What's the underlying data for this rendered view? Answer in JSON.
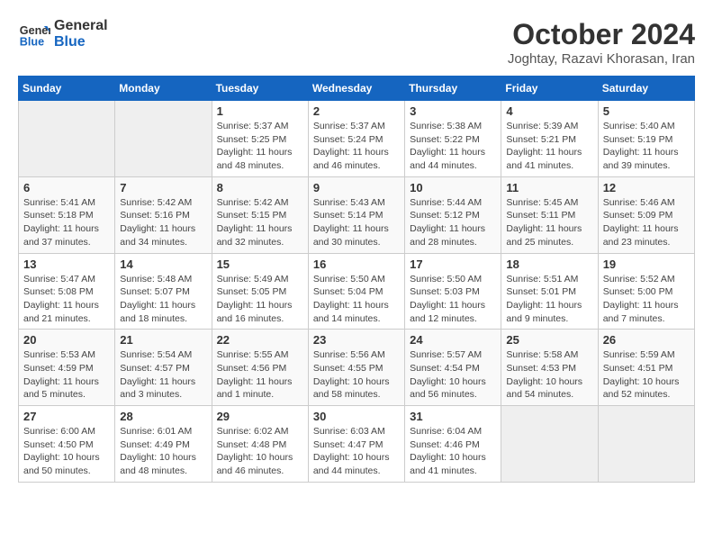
{
  "header": {
    "logo_line1": "General",
    "logo_line2": "Blue",
    "month_title": "October 2024",
    "location": "Joghtay, Razavi Khorasan, Iran"
  },
  "weekdays": [
    "Sunday",
    "Monday",
    "Tuesday",
    "Wednesday",
    "Thursday",
    "Friday",
    "Saturday"
  ],
  "weeks": [
    [
      {
        "day": null
      },
      {
        "day": null
      },
      {
        "day": "1",
        "sunrise": "Sunrise: 5:37 AM",
        "sunset": "Sunset: 5:25 PM",
        "daylight": "Daylight: 11 hours and 48 minutes."
      },
      {
        "day": "2",
        "sunrise": "Sunrise: 5:37 AM",
        "sunset": "Sunset: 5:24 PM",
        "daylight": "Daylight: 11 hours and 46 minutes."
      },
      {
        "day": "3",
        "sunrise": "Sunrise: 5:38 AM",
        "sunset": "Sunset: 5:22 PM",
        "daylight": "Daylight: 11 hours and 44 minutes."
      },
      {
        "day": "4",
        "sunrise": "Sunrise: 5:39 AM",
        "sunset": "Sunset: 5:21 PM",
        "daylight": "Daylight: 11 hours and 41 minutes."
      },
      {
        "day": "5",
        "sunrise": "Sunrise: 5:40 AM",
        "sunset": "Sunset: 5:19 PM",
        "daylight": "Daylight: 11 hours and 39 minutes."
      }
    ],
    [
      {
        "day": "6",
        "sunrise": "Sunrise: 5:41 AM",
        "sunset": "Sunset: 5:18 PM",
        "daylight": "Daylight: 11 hours and 37 minutes."
      },
      {
        "day": "7",
        "sunrise": "Sunrise: 5:42 AM",
        "sunset": "Sunset: 5:16 PM",
        "daylight": "Daylight: 11 hours and 34 minutes."
      },
      {
        "day": "8",
        "sunrise": "Sunrise: 5:42 AM",
        "sunset": "Sunset: 5:15 PM",
        "daylight": "Daylight: 11 hours and 32 minutes."
      },
      {
        "day": "9",
        "sunrise": "Sunrise: 5:43 AM",
        "sunset": "Sunset: 5:14 PM",
        "daylight": "Daylight: 11 hours and 30 minutes."
      },
      {
        "day": "10",
        "sunrise": "Sunrise: 5:44 AM",
        "sunset": "Sunset: 5:12 PM",
        "daylight": "Daylight: 11 hours and 28 minutes."
      },
      {
        "day": "11",
        "sunrise": "Sunrise: 5:45 AM",
        "sunset": "Sunset: 5:11 PM",
        "daylight": "Daylight: 11 hours and 25 minutes."
      },
      {
        "day": "12",
        "sunrise": "Sunrise: 5:46 AM",
        "sunset": "Sunset: 5:09 PM",
        "daylight": "Daylight: 11 hours and 23 minutes."
      }
    ],
    [
      {
        "day": "13",
        "sunrise": "Sunrise: 5:47 AM",
        "sunset": "Sunset: 5:08 PM",
        "daylight": "Daylight: 11 hours and 21 minutes."
      },
      {
        "day": "14",
        "sunrise": "Sunrise: 5:48 AM",
        "sunset": "Sunset: 5:07 PM",
        "daylight": "Daylight: 11 hours and 18 minutes."
      },
      {
        "day": "15",
        "sunrise": "Sunrise: 5:49 AM",
        "sunset": "Sunset: 5:05 PM",
        "daylight": "Daylight: 11 hours and 16 minutes."
      },
      {
        "day": "16",
        "sunrise": "Sunrise: 5:50 AM",
        "sunset": "Sunset: 5:04 PM",
        "daylight": "Daylight: 11 hours and 14 minutes."
      },
      {
        "day": "17",
        "sunrise": "Sunrise: 5:50 AM",
        "sunset": "Sunset: 5:03 PM",
        "daylight": "Daylight: 11 hours and 12 minutes."
      },
      {
        "day": "18",
        "sunrise": "Sunrise: 5:51 AM",
        "sunset": "Sunset: 5:01 PM",
        "daylight": "Daylight: 11 hours and 9 minutes."
      },
      {
        "day": "19",
        "sunrise": "Sunrise: 5:52 AM",
        "sunset": "Sunset: 5:00 PM",
        "daylight": "Daylight: 11 hours and 7 minutes."
      }
    ],
    [
      {
        "day": "20",
        "sunrise": "Sunrise: 5:53 AM",
        "sunset": "Sunset: 4:59 PM",
        "daylight": "Daylight: 11 hours and 5 minutes."
      },
      {
        "day": "21",
        "sunrise": "Sunrise: 5:54 AM",
        "sunset": "Sunset: 4:57 PM",
        "daylight": "Daylight: 11 hours and 3 minutes."
      },
      {
        "day": "22",
        "sunrise": "Sunrise: 5:55 AM",
        "sunset": "Sunset: 4:56 PM",
        "daylight": "Daylight: 11 hours and 1 minute."
      },
      {
        "day": "23",
        "sunrise": "Sunrise: 5:56 AM",
        "sunset": "Sunset: 4:55 PM",
        "daylight": "Daylight: 10 hours and 58 minutes."
      },
      {
        "day": "24",
        "sunrise": "Sunrise: 5:57 AM",
        "sunset": "Sunset: 4:54 PM",
        "daylight": "Daylight: 10 hours and 56 minutes."
      },
      {
        "day": "25",
        "sunrise": "Sunrise: 5:58 AM",
        "sunset": "Sunset: 4:53 PM",
        "daylight": "Daylight: 10 hours and 54 minutes."
      },
      {
        "day": "26",
        "sunrise": "Sunrise: 5:59 AM",
        "sunset": "Sunset: 4:51 PM",
        "daylight": "Daylight: 10 hours and 52 minutes."
      }
    ],
    [
      {
        "day": "27",
        "sunrise": "Sunrise: 6:00 AM",
        "sunset": "Sunset: 4:50 PM",
        "daylight": "Daylight: 10 hours and 50 minutes."
      },
      {
        "day": "28",
        "sunrise": "Sunrise: 6:01 AM",
        "sunset": "Sunset: 4:49 PM",
        "daylight": "Daylight: 10 hours and 48 minutes."
      },
      {
        "day": "29",
        "sunrise": "Sunrise: 6:02 AM",
        "sunset": "Sunset: 4:48 PM",
        "daylight": "Daylight: 10 hours and 46 minutes."
      },
      {
        "day": "30",
        "sunrise": "Sunrise: 6:03 AM",
        "sunset": "Sunset: 4:47 PM",
        "daylight": "Daylight: 10 hours and 44 minutes."
      },
      {
        "day": "31",
        "sunrise": "Sunrise: 6:04 AM",
        "sunset": "Sunset: 4:46 PM",
        "daylight": "Daylight: 10 hours and 41 minutes."
      },
      {
        "day": null
      },
      {
        "day": null
      }
    ]
  ]
}
